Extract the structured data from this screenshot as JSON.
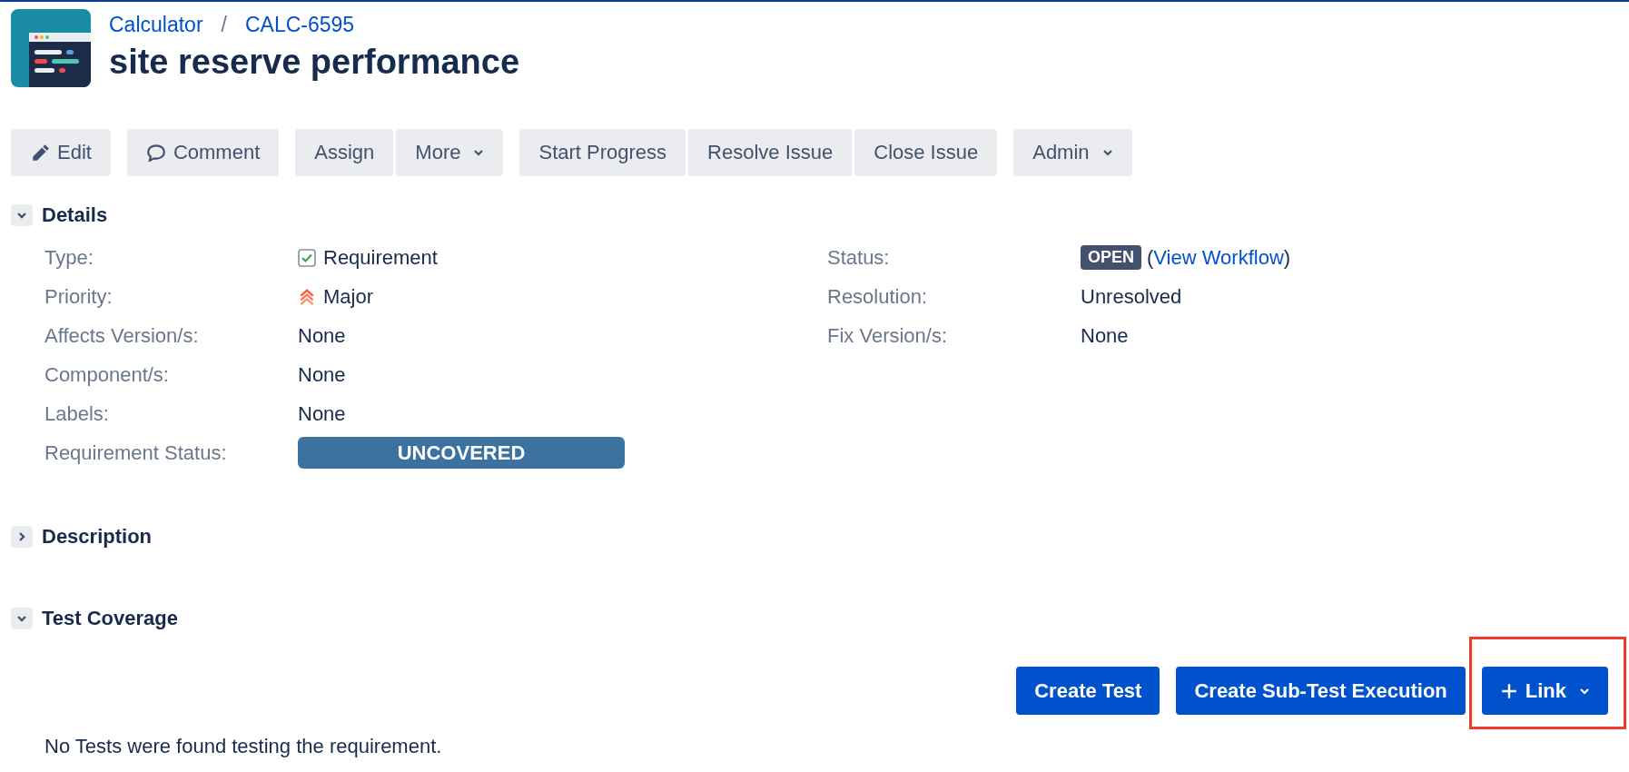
{
  "breadcrumbs": [
    {
      "text": "Calculator"
    },
    {
      "text": "CALC-6595"
    }
  ],
  "breadcrumb_separator": "/",
  "title": "site reserve performance",
  "toolbar": [
    [
      {
        "label": "Edit",
        "kind": "edit",
        "dropdown": false
      }
    ],
    [
      {
        "label": "Comment",
        "kind": "comment",
        "dropdown": false
      }
    ],
    [
      {
        "label": "Assign",
        "kind": "plain",
        "dropdown": false
      },
      {
        "label": "More",
        "kind": "plain",
        "dropdown": true
      }
    ],
    [
      {
        "label": "Start Progress",
        "kind": "plain",
        "dropdown": false
      },
      {
        "label": "Resolve Issue",
        "kind": "plain",
        "dropdown": false
      },
      {
        "label": "Close Issue",
        "kind": "plain",
        "dropdown": false
      }
    ],
    [
      {
        "label": "Admin",
        "kind": "plain",
        "dropdown": true
      }
    ]
  ],
  "sections": [
    {
      "kind": "details",
      "title": "Details",
      "expanded": true,
      "left_fields": [
        {
          "kind": "type",
          "label": "Type:",
          "value": "Requirement"
        },
        {
          "kind": "priority",
          "label": "Priority:",
          "value": "Major"
        },
        {
          "kind": "text",
          "label": "Affects Version/s:",
          "value": "None"
        },
        {
          "kind": "text",
          "label": "Component/s:",
          "value": "None"
        },
        {
          "kind": "text",
          "label": "Labels:",
          "value": "None"
        },
        {
          "kind": "badge",
          "label": "Requirement Status:",
          "value": "UNCOVERED",
          "color": "#3b72a0"
        }
      ],
      "right_fields": [
        {
          "kind": "status",
          "label": "Status:",
          "value": "OPEN",
          "before": "(",
          "link": "View Workflow",
          "after": ")"
        },
        {
          "kind": "text",
          "label": "Resolution:",
          "value": "Unresolved"
        },
        {
          "kind": "text",
          "label": "Fix Version/s:",
          "value": "None"
        }
      ]
    },
    {
      "kind": "description",
      "title": "Description",
      "expanded": false
    },
    {
      "kind": "coverage",
      "title": "Test Coverage",
      "expanded": true,
      "buttons": [
        {
          "label": "Create Test",
          "kind": "plain",
          "dropdown": false,
          "highlighted": false
        },
        {
          "label": "Create Sub-Test Execution",
          "kind": "plain",
          "dropdown": false,
          "highlighted": false
        },
        {
          "label": "Link",
          "kind": "add",
          "dropdown": true,
          "highlighted": true
        }
      ],
      "message": "No Tests were found testing the requirement."
    }
  ]
}
